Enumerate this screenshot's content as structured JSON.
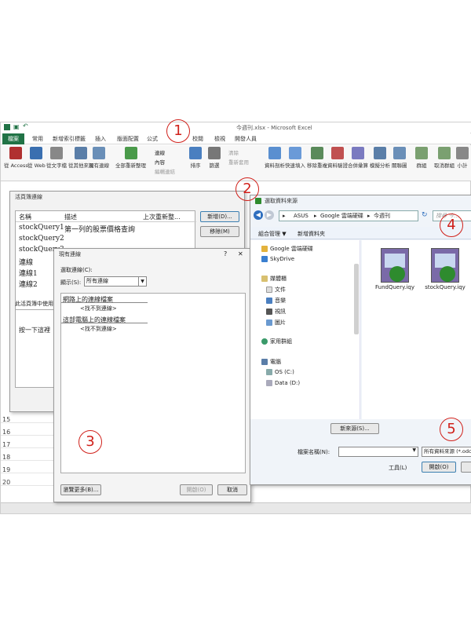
{
  "excel": {
    "title": "今週刊.xlsx - Microsoft Excel",
    "file_tab": "檔案",
    "tabs": [
      "常用",
      "新增索引標籤",
      "插入",
      "版面配置",
      "公式",
      "校閱",
      "檢視",
      "開發人員"
    ],
    "ribbon_buttons": [
      "從 Access",
      "從 Web",
      "從文字檔",
      "從其他來源",
      "現有連線",
      "全部重新整理",
      "連線",
      "內容",
      "編輯連結",
      "排序",
      "篩選",
      "清除",
      "重新套用",
      "資料剖析",
      "快速填入",
      "移除重複",
      "資料驗證",
      "合併彙算",
      "模擬分析",
      "關聯圖",
      "群組",
      "取消群組",
      "小計"
    ],
    "row_numbers": [
      "15",
      "16",
      "17",
      "18",
      "19",
      "20"
    ]
  },
  "workbook_connections": {
    "title": "活頁簿連線",
    "col_name": "名稱",
    "col_desc": "描述",
    "col_last": "上次重新整...",
    "rows": [
      {
        "name": "stockQuery1",
        "desc": "第一列的股票價格查詢"
      },
      {
        "name": "stockQuery2",
        "desc": ""
      },
      {
        "name": "stockQuery3",
        "desc": ""
      },
      {
        "name": "連線",
        "desc": ""
      },
      {
        "name": "連線1",
        "desc": ""
      },
      {
        "name": "連線2",
        "desc": ""
      }
    ],
    "add_button": "新增(D)...",
    "remove_button": "移除(M)",
    "used_label": "此活頁簿中使用連",
    "click_here": "按一下這裡"
  },
  "existing_connections": {
    "title": "現有連線",
    "select_label": "選取連線(C):",
    "show_label": "顯示(S):",
    "show_value": "所有連線",
    "section_network": "網路上的連線檔案",
    "not_found1": "<找不到連線>",
    "section_computer": "這部電腦上的連線檔案",
    "not_found2": "<找不到連線>",
    "browse_button": "瀏覽更多(B)...",
    "open_button": "開啟(O)",
    "cancel_button": "取消"
  },
  "select_source": {
    "title": "選取資料來源",
    "breadcrumb": [
      "ASUS",
      "Google 雲端硬碟",
      "今週刊"
    ],
    "search_placeholder": "搜尋 今...",
    "organize": "組合管理 ▼",
    "new_folder": "新增資料夾",
    "nav_items": [
      "Google 雲端硬碟",
      "SkyDrive",
      "媒體櫃",
      "文件",
      "音樂",
      "視訊",
      "圖片",
      "家用群組",
      "電腦",
      "OS (C:)",
      "Data (D:)"
    ],
    "files": [
      "FundQuery.iqy",
      "stockQuery.iqy"
    ],
    "new_source_button": "新來源(S)...",
    "filename_label": "檔案名稱(N):",
    "filetype_value": "所有資料來源 (*.odc;",
    "tools_label": "工具(L)",
    "open_button": "開啟(O)"
  },
  "annotations": [
    "1",
    "2",
    "3",
    "4",
    "5"
  ]
}
